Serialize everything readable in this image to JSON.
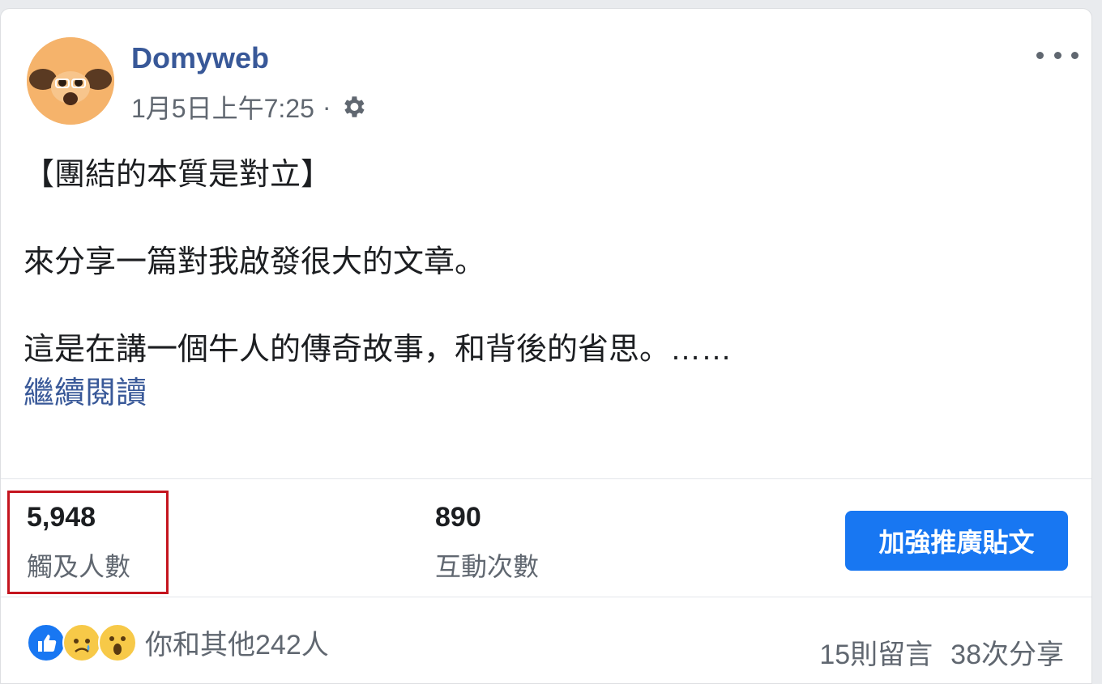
{
  "post": {
    "page_name": "Domyweb",
    "timestamp": "1月5日上午7:25",
    "separator": "·",
    "avatar_icon": "avatar-icon",
    "body": {
      "line1": "【團結的本質是對立】",
      "line2": "來分享一篇對我啟發很大的文章。",
      "line3": "這是在講一個牛人的傳奇故事，和背後的省思。……",
      "read_more": "繼續閱讀"
    }
  },
  "insights": {
    "reach_value": "5,948",
    "reach_label": "觸及人數",
    "engagement_value": "890",
    "engagement_label": "互動次數",
    "boost_button": "加強推廣貼文",
    "highlight_color": "#c4141e"
  },
  "footer": {
    "reactions": [
      "like-icon",
      "sad-icon",
      "wow-icon"
    ],
    "reaction_text": "你和其他242人",
    "comments": "15則留言",
    "shares": "38次分享"
  },
  "colors": {
    "link": "#385898",
    "button": "#1877f2",
    "secondary_text": "#606770"
  }
}
